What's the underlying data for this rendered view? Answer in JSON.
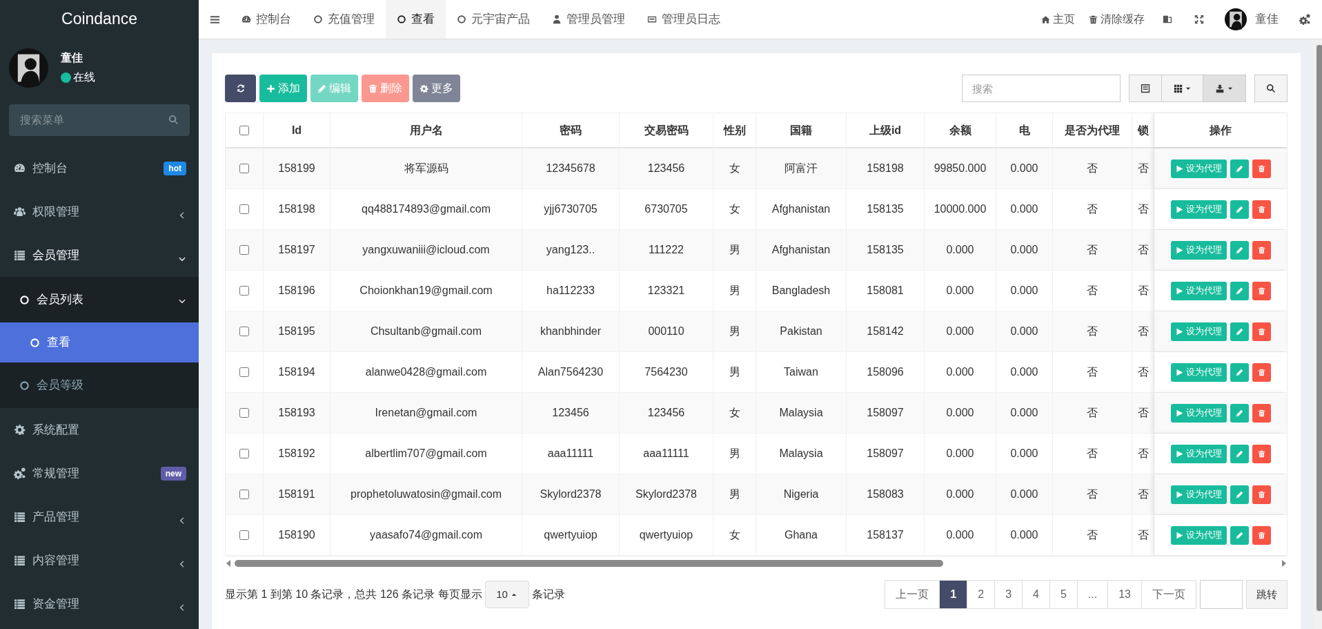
{
  "sidebar": {
    "logo": "Coindance",
    "user": {
      "name": "童佳",
      "status": "在线"
    },
    "search": {
      "placeholder": "搜索菜单"
    },
    "menu": [
      {
        "label": "控制台",
        "kind": "link",
        "badge": "hot",
        "color": "#1e88e5"
      },
      {
        "label": "权限管理",
        "kind": "group",
        "expanded": false
      },
      {
        "label": "会员管理",
        "kind": "group",
        "expanded": true,
        "children": [
          {
            "label": "会员列表",
            "kind": "group",
            "expanded": true,
            "children": [
              {
                "label": "查看",
                "selected": true
              }
            ]
          },
          {
            "label": "会员等级",
            "kind": "link",
            "selected": false
          }
        ]
      },
      {
        "label": "系统配置",
        "kind": "link"
      },
      {
        "label": "常规管理",
        "kind": "link",
        "badge": "new",
        "color": "#605ca8"
      },
      {
        "label": "产品管理",
        "kind": "group",
        "expanded": false
      },
      {
        "label": "内容管理",
        "kind": "group",
        "expanded": false
      },
      {
        "label": "资金管理",
        "kind": "group",
        "expanded": false
      }
    ]
  },
  "header": {
    "tabs": [
      {
        "label": "控制台",
        "selected": false
      },
      {
        "label": "充值管理",
        "selected": false
      },
      {
        "label": "查看",
        "selected": true
      },
      {
        "label": "元宇宙产品",
        "selected": false
      },
      {
        "label": "管理员管理",
        "selected": false
      },
      {
        "label": "管理员日志",
        "selected": false
      }
    ],
    "links": [
      "主页",
      "清除缓存"
    ],
    "user_name": "童佳"
  },
  "toolbar": {
    "buttons": [
      {
        "label": "添加",
        "disabled": false
      },
      {
        "label": "编辑",
        "disabled": true
      },
      {
        "label": "删除",
        "disabled": true
      },
      {
        "label": "更多",
        "disabled": false
      }
    ],
    "search": {
      "placeholder": "搜索"
    }
  },
  "table": {
    "select_all_checked": false,
    "columns": [
      "Id",
      "用户名",
      "密码",
      "交易密码",
      "性别",
      "国籍",
      "上级id",
      "余额",
      "电",
      "是否为代理",
      "锁",
      "操作"
    ],
    "rows": [
      {
        "checked": false,
        "cells": [
          "158199",
          "将军源码",
          "12345678",
          "123456",
          "女",
          "阿富汗",
          "158198",
          "99850.000",
          "0.000",
          "否",
          "否"
        ],
        "action": "设为代理"
      },
      {
        "checked": false,
        "cells": [
          "158198",
          "qq488174893@gmail.com",
          "yjj6730705",
          "6730705",
          "女",
          "Afghanistan",
          "158135",
          "10000.000",
          "0.000",
          "否",
          "否"
        ],
        "action": "设为代理"
      },
      {
        "checked": false,
        "cells": [
          "158197",
          "yangxuwaniii@icloud.com",
          "yang123..",
          "111222",
          "男",
          "Afghanistan",
          "158135",
          "0.000",
          "0.000",
          "否",
          "否"
        ],
        "action": "设为代理"
      },
      {
        "checked": false,
        "cells": [
          "158196",
          "Choionkhan19@gmail.com",
          "ha112233",
          "123321",
          "男",
          "Bangladesh",
          "158081",
          "0.000",
          "0.000",
          "否",
          "否"
        ],
        "action": "设为代理"
      },
      {
        "checked": false,
        "cells": [
          "158195",
          "Chsultanb@gmail.com",
          "khanbhinder",
          "000110",
          "男",
          "Pakistan",
          "158142",
          "0.000",
          "0.000",
          "否",
          "否"
        ],
        "action": "设为代理"
      },
      {
        "checked": false,
        "cells": [
          "158194",
          "alanwe0428@gmail.com",
          "Alan7564230",
          "7564230",
          "男",
          "Taiwan",
          "158096",
          "0.000",
          "0.000",
          "否",
          "否"
        ],
        "action": "设为代理"
      },
      {
        "checked": false,
        "cells": [
          "158193",
          "Irenetan@gmail.com",
          "123456",
          "123456",
          "女",
          "Malaysia",
          "158097",
          "0.000",
          "0.000",
          "否",
          "否"
        ],
        "action": "设为代理"
      },
      {
        "checked": false,
        "cells": [
          "158192",
          "albertlim707@gmail.com",
          "aaa11111",
          "aaa11111",
          "男",
          "Malaysia",
          "158097",
          "0.000",
          "0.000",
          "否",
          "否"
        ],
        "action": "设为代理"
      },
      {
        "checked": false,
        "cells": [
          "158191",
          "prophetoluwatosin@gmail.com",
          "Skylord2378",
          "Skylord2378",
          "男",
          "Nigeria",
          "158083",
          "0.000",
          "0.000",
          "否",
          "否"
        ],
        "action": "设为代理"
      },
      {
        "checked": false,
        "cells": [
          "158190",
          "yaasafo74@gmail.com",
          "qwertyuiop",
          "qwertyuiop",
          "女",
          "Ghana",
          "158137",
          "0.000",
          "0.000",
          "否",
          "否"
        ],
        "action": "设为代理"
      }
    ]
  },
  "footer": {
    "summary": "显示第 1 到第 10 条记录，总共 126 条记录 每页显示",
    "page_size": "10",
    "suffix": "条记录",
    "pages": [
      {
        "label": "上一页",
        "selected": false
      },
      {
        "label": "1",
        "selected": true
      },
      {
        "label": "2",
        "selected": false
      },
      {
        "label": "3",
        "selected": false
      },
      {
        "label": "4",
        "selected": false
      },
      {
        "label": "5",
        "selected": false
      },
      {
        "label": "...",
        "selected": false
      },
      {
        "label": "13",
        "selected": false
      },
      {
        "label": "下一页",
        "selected": false
      }
    ],
    "jump_button": "跳转"
  }
}
